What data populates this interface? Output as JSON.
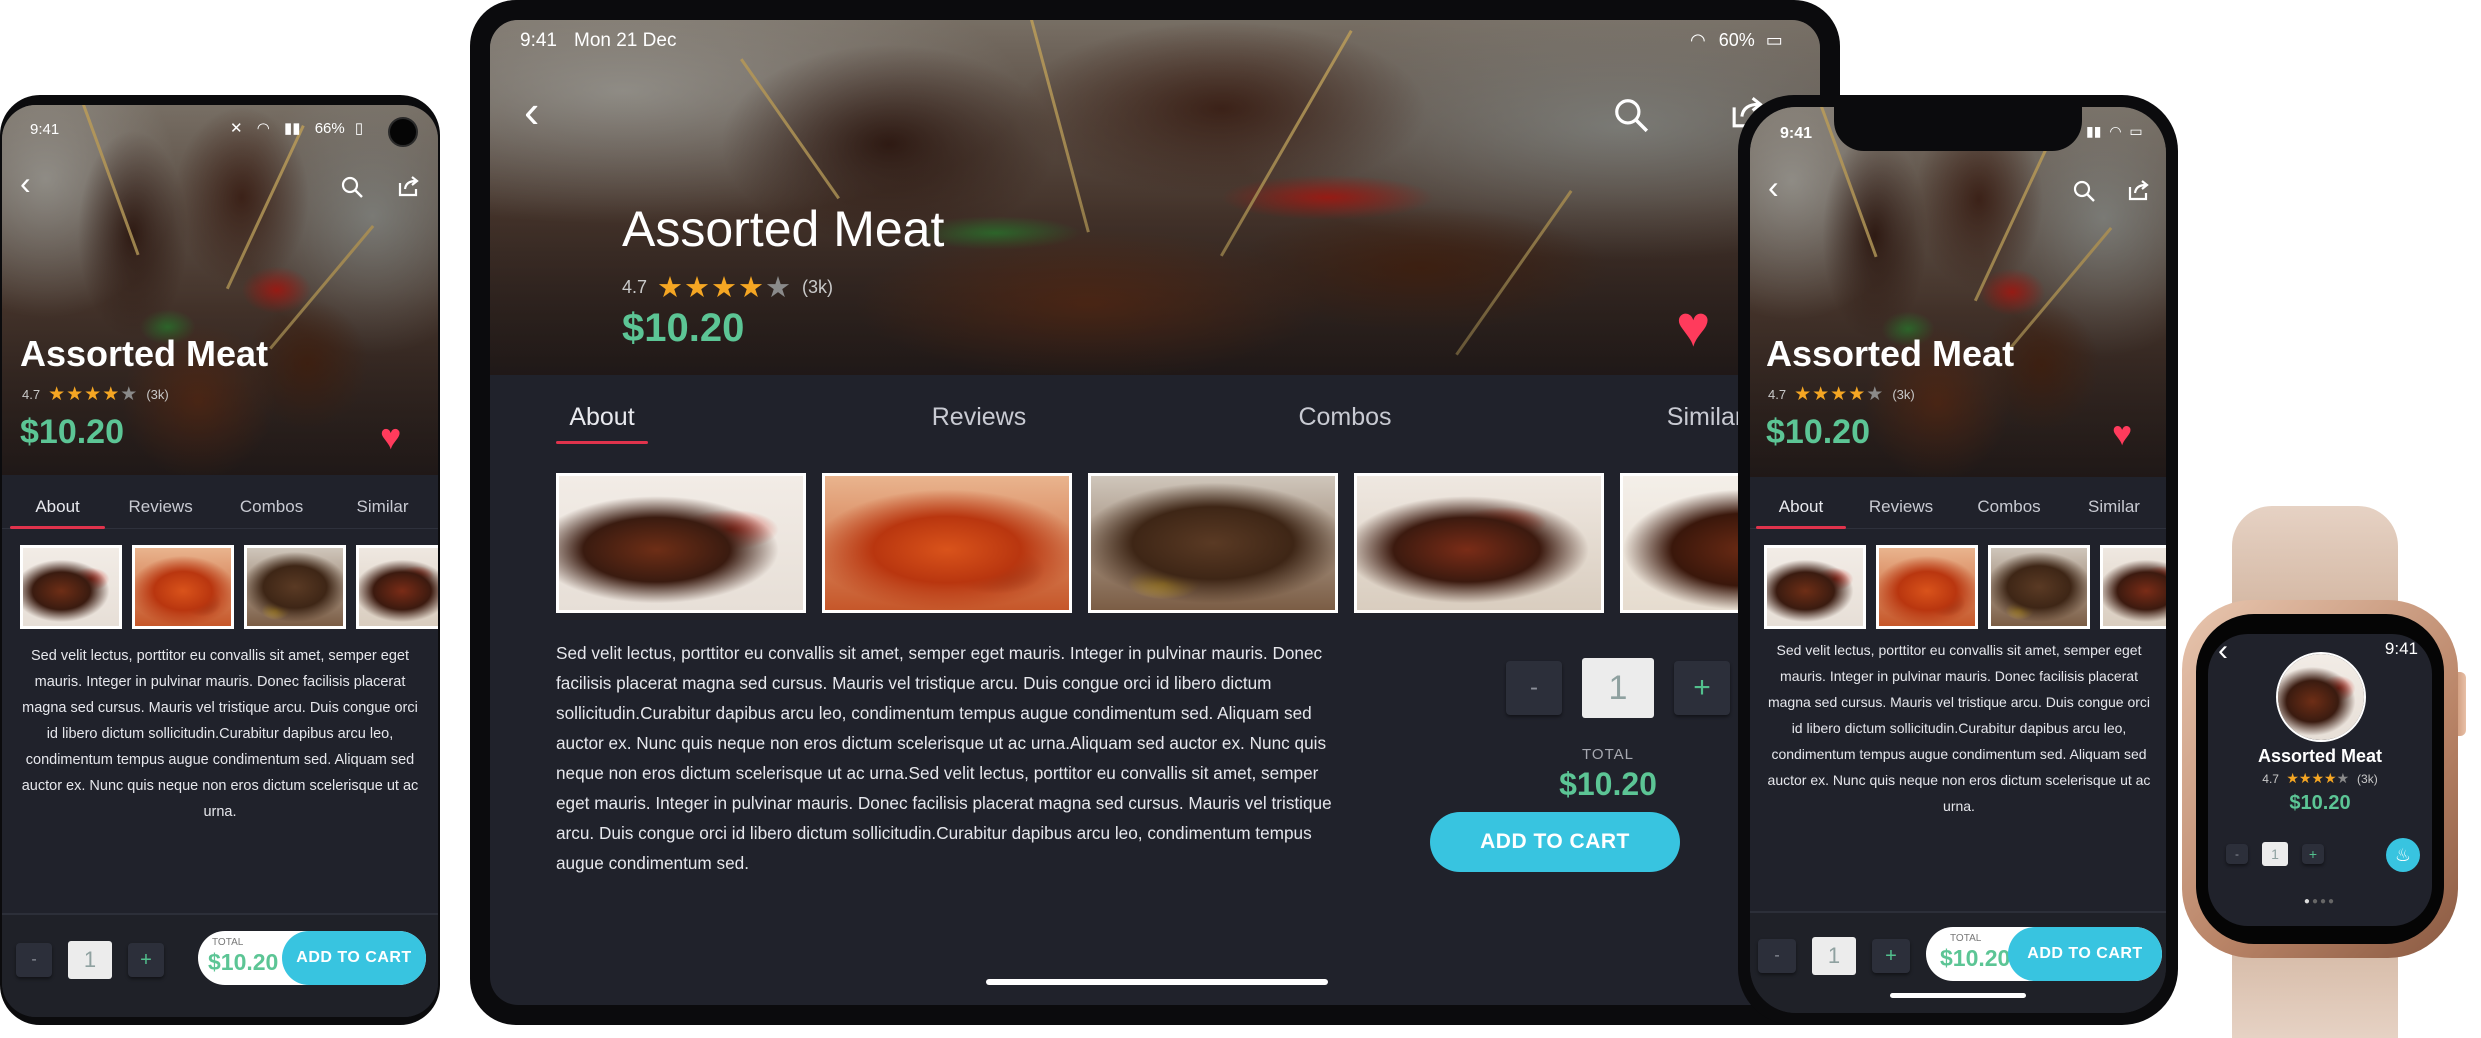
{
  "product": {
    "name": "Assorted Meat",
    "rating": "4.7",
    "review_count": "(3k)",
    "price": "$10.20",
    "stars_filled": 4,
    "stars_total": 5
  },
  "tabs": [
    "About",
    "Reviews",
    "Combos",
    "Similar"
  ],
  "description": "Sed velit lectus, porttitor eu convallis sit amet, semper eget mauris. Integer in pulvinar mauris. Donec facilisis placerat magna sed cursus. Mauris vel tristique arcu. Duis congue orci id libero dictum sollicitudin.Curabitur dapibus arcu leo, condimentum tempus augue condimentum sed. Aliquam sed auctor ex. Nunc quis neque non eros dictum scelerisque ut ac urna.",
  "tablet_description": "Sed velit lectus, porttitor eu convallis sit amet, semper eget mauris. Integer in pulvinar mauris. Donec facilisis placerat magna sed cursus. Mauris vel tristique arcu. Duis congue orci id libero dictum sollicitudin.Curabitur dapibus arcu leo, condimentum tempus augue condimentum sed. Aliquam sed auctor ex. Nunc quis neque non eros dictum scelerisque ut ac urna.Aliquam sed auctor ex. Nunc quis neque non eros dictum scelerisque ut ac urna.Sed velit lectus, porttitor eu convallis sit amet, semper eget mauris. Integer in pulvinar mauris. Donec facilisis placerat magna sed cursus. Mauris vel tristique arcu. Duis congue orci id libero dictum sollicitudin.Curabitur dapibus arcu leo, condimentum tempus augue condimentum sed.",
  "cart": {
    "quantity": "1",
    "minus": "-",
    "plus": "+",
    "total_label": "TOTAL",
    "total_label_upper": "TOTAL",
    "total": "$10.20",
    "button": "ADD TO CART"
  },
  "tablet_status": {
    "time": "9:41",
    "date": "Mon 21 Dec",
    "battery": "60%"
  },
  "android_status": {
    "time": "9:41",
    "battery": "66%"
  },
  "iphone_status": {
    "time": "9:41"
  },
  "watch": {
    "time": "9:41"
  },
  "icons": {
    "back": "chevron-left-icon",
    "search": "search-icon",
    "share": "share-icon",
    "favorite": "heart-icon",
    "wifi": "wifi-icon",
    "battery": "battery-icon",
    "chef": "chef-hat-icon"
  },
  "colors": {
    "background": "#20222b",
    "price": "#5cc595",
    "accent_button": "#38c4e0",
    "heart": "#ff3b5c",
    "tab_underline": "#e0334c",
    "star": "#f5a623"
  }
}
